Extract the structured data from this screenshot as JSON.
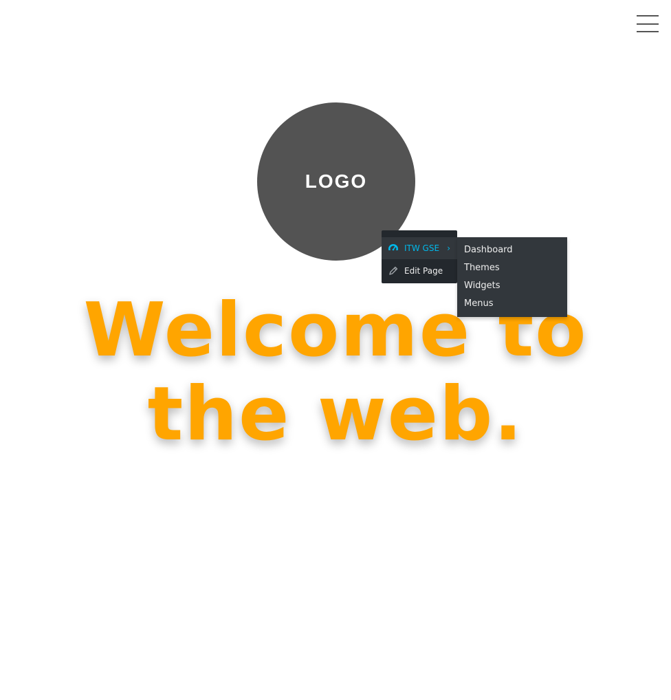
{
  "logo": {
    "text": "LOGO"
  },
  "headline": {
    "line1": "Welcome to",
    "line2": "the web."
  },
  "admin_menu": {
    "site_label": "ITW GSE",
    "edit_label": "Edit Page",
    "chevron": "›",
    "icons": {
      "site": "dashboard-gauge-icon",
      "edit": "pencil-icon"
    },
    "colors": {
      "accent": "#00b9eb",
      "bar_bg": "#23282d",
      "submenu_bg": "#32373c"
    }
  },
  "submenu": {
    "items": [
      "Dashboard",
      "Themes",
      "Widgets",
      "Menus"
    ]
  },
  "colors": {
    "headline": "#ffa500",
    "logo_bg": "#535353"
  }
}
